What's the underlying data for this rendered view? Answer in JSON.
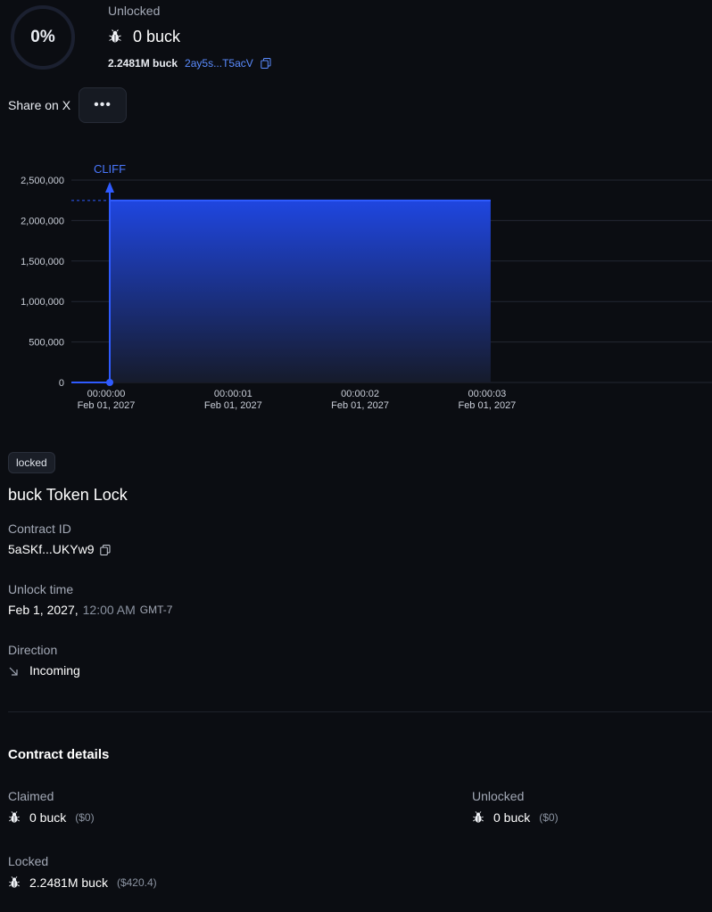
{
  "header": {
    "percent": "0%",
    "progress_fraction": 0,
    "unlocked_label": "Unlocked",
    "unlocked_amount": "0 buck",
    "total_amount": "2.2481M buck",
    "address": "2ay5s...T5acV",
    "token_icon": "bug-token-icon"
  },
  "share": {
    "label": "Share on X",
    "more_label": "•••"
  },
  "chart_data": {
    "type": "area",
    "x": [
      "00:00:00",
      "00:00:01",
      "00:00:02",
      "00:00:03"
    ],
    "x_dates": [
      "Feb 01, 2027",
      "Feb 01, 2027",
      "Feb 01, 2027",
      "Feb 01, 2027"
    ],
    "y_ticks": [
      "2,500,000",
      "2,000,000",
      "1,500,000",
      "1,000,000",
      "500,000",
      "0"
    ],
    "y_tick_values": [
      2500000,
      2000000,
      1500000,
      1000000,
      500000,
      0
    ],
    "ylim": [
      0,
      2500000
    ],
    "cliff_label": "CLIFF",
    "cliff_x": 0,
    "locked_value": 2248100,
    "locked_range": [
      0,
      3
    ],
    "colors": {
      "fill_top": "#1f46e0",
      "fill_bottom": "#161b2b",
      "line": "#2f5bff",
      "grid": "#232733",
      "axis_text": "#c9ced8"
    }
  },
  "status_badge": "locked",
  "lock_title": "buck Token Lock",
  "contract": {
    "label": "Contract ID",
    "value": "5aSKf...UKYw9"
  },
  "unlock": {
    "label": "Unlock time",
    "date": "Feb 1, 2027,",
    "time": "12:00 AM",
    "tz": "GMT-7"
  },
  "direction": {
    "label": "Direction",
    "value": "Incoming",
    "icon": "arrow-down-right-icon"
  },
  "details": {
    "title": "Contract details",
    "claimed_label": "Claimed",
    "claimed_amount": "0 buck",
    "claimed_usd": "($0)",
    "unlocked_label": "Unlocked",
    "unlocked_amount": "0 buck",
    "unlocked_usd": "($0)",
    "locked_label": "Locked",
    "locked_amount": "2.2481M buck",
    "locked_usd": "($420.4)"
  }
}
